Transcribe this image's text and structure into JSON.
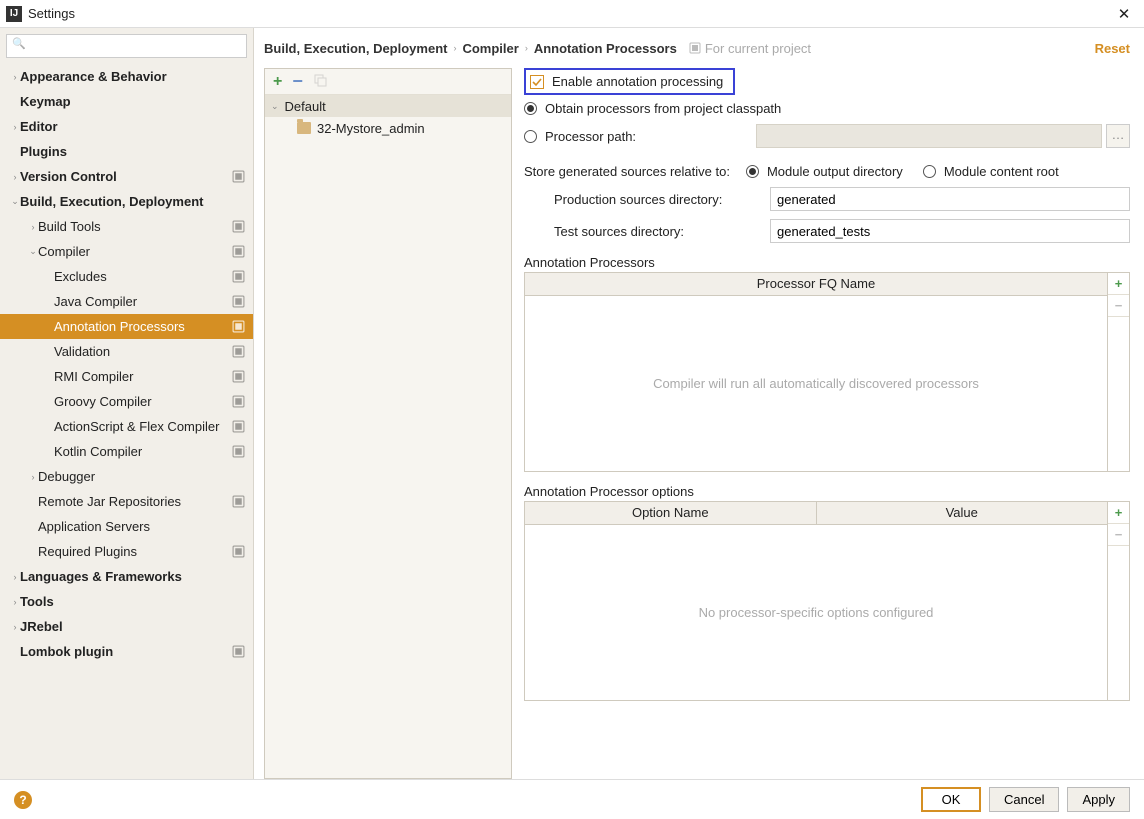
{
  "window": {
    "title": "Settings"
  },
  "search": {
    "placeholder": ""
  },
  "tree": [
    {
      "label": "Appearance & Behavior",
      "depth": 0,
      "bold": true,
      "twisty": "›"
    },
    {
      "label": "Keymap",
      "depth": 0,
      "bold": true
    },
    {
      "label": "Editor",
      "depth": 0,
      "bold": true,
      "twisty": "›"
    },
    {
      "label": "Plugins",
      "depth": 0,
      "bold": true
    },
    {
      "label": "Version Control",
      "depth": 0,
      "bold": true,
      "twisty": "›",
      "badge": true
    },
    {
      "label": "Build, Execution, Deployment",
      "depth": 0,
      "bold": true,
      "twisty": "⌄"
    },
    {
      "label": "Build Tools",
      "depth": 1,
      "twisty": "›",
      "badge": true
    },
    {
      "label": "Compiler",
      "depth": 1,
      "twisty": "⌄",
      "badge": true
    },
    {
      "label": "Excludes",
      "depth": 2,
      "badge": true
    },
    {
      "label": "Java Compiler",
      "depth": 2,
      "badge": true
    },
    {
      "label": "Annotation Processors",
      "depth": 2,
      "badge": true,
      "selected": true
    },
    {
      "label": "Validation",
      "depth": 2,
      "badge": true
    },
    {
      "label": "RMI Compiler",
      "depth": 2,
      "badge": true
    },
    {
      "label": "Groovy Compiler",
      "depth": 2,
      "badge": true
    },
    {
      "label": "ActionScript & Flex Compiler",
      "depth": 2,
      "badge": true
    },
    {
      "label": "Kotlin Compiler",
      "depth": 2,
      "badge": true
    },
    {
      "label": "Debugger",
      "depth": 1,
      "twisty": "›"
    },
    {
      "label": "Remote Jar Repositories",
      "depth": 1,
      "badge": true
    },
    {
      "label": "Application Servers",
      "depth": 1
    },
    {
      "label": "Required Plugins",
      "depth": 1,
      "badge": true
    },
    {
      "label": "Languages & Frameworks",
      "depth": 0,
      "bold": true,
      "twisty": "›"
    },
    {
      "label": "Tools",
      "depth": 0,
      "bold": true,
      "twisty": "›"
    },
    {
      "label": "JRebel",
      "depth": 0,
      "bold": true,
      "twisty": "›"
    },
    {
      "label": "Lombok plugin",
      "depth": 0,
      "bold": true,
      "badge": true
    }
  ],
  "crumbs": [
    "Build, Execution, Deployment",
    "Compiler",
    "Annotation Processors"
  ],
  "for_project": "For current project",
  "reset": "Reset",
  "profiles": {
    "default_label": "Default",
    "project": "32-Mystore_admin"
  },
  "form": {
    "enable": "Enable annotation processing",
    "obtain": "Obtain processors from project classpath",
    "processor_path": "Processor path:",
    "store_relative": "Store generated sources relative to:",
    "module_output": "Module output directory",
    "module_content": "Module content root",
    "prod_dir_label": "Production sources directory:",
    "prod_dir_value": "generated",
    "test_dir_label": "Test sources directory:",
    "test_dir_value": "generated_tests",
    "ap_title": "Annotation Processors",
    "ap_header": "Processor FQ Name",
    "ap_empty": "Compiler will run all automatically discovered processors",
    "opt_title": "Annotation Processor options",
    "opt_headers": [
      "Option Name",
      "Value"
    ],
    "opt_empty": "No processor-specific options configured"
  },
  "buttons": {
    "ok": "OK",
    "cancel": "Cancel",
    "apply": "Apply"
  }
}
